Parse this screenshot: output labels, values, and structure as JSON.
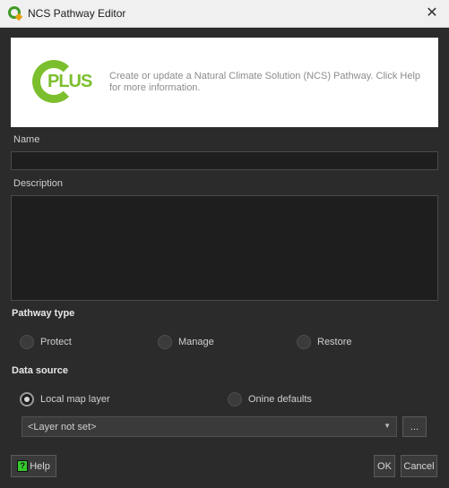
{
  "window": {
    "title": "NCS Pathway Editor",
    "close_glyph": "✕",
    "icon": "qgis-icon"
  },
  "banner": {
    "logo_text": "PLUS",
    "text": "Create or update a Natural Climate Solution (NCS) Pathway. Click Help for more information."
  },
  "form": {
    "name_label": "Name",
    "name_value": "",
    "description_label": "Description",
    "description_value": ""
  },
  "pathway_type": {
    "heading": "Pathway type",
    "options": [
      "Protect",
      "Manage",
      "Restore"
    ],
    "selected": null
  },
  "data_source": {
    "heading": "Data source",
    "options": [
      "Local map layer",
      "Onine defaults"
    ],
    "selected": "Local map layer",
    "layer_combo_value": "<Layer not set>",
    "browse_label": "..."
  },
  "buttons": {
    "help": "Help",
    "ok": "OK",
    "cancel": "Cancel"
  },
  "colors": {
    "accent_green": "#7cbf2e",
    "help_green": "#36c92d",
    "background": "#2b2b2b"
  }
}
